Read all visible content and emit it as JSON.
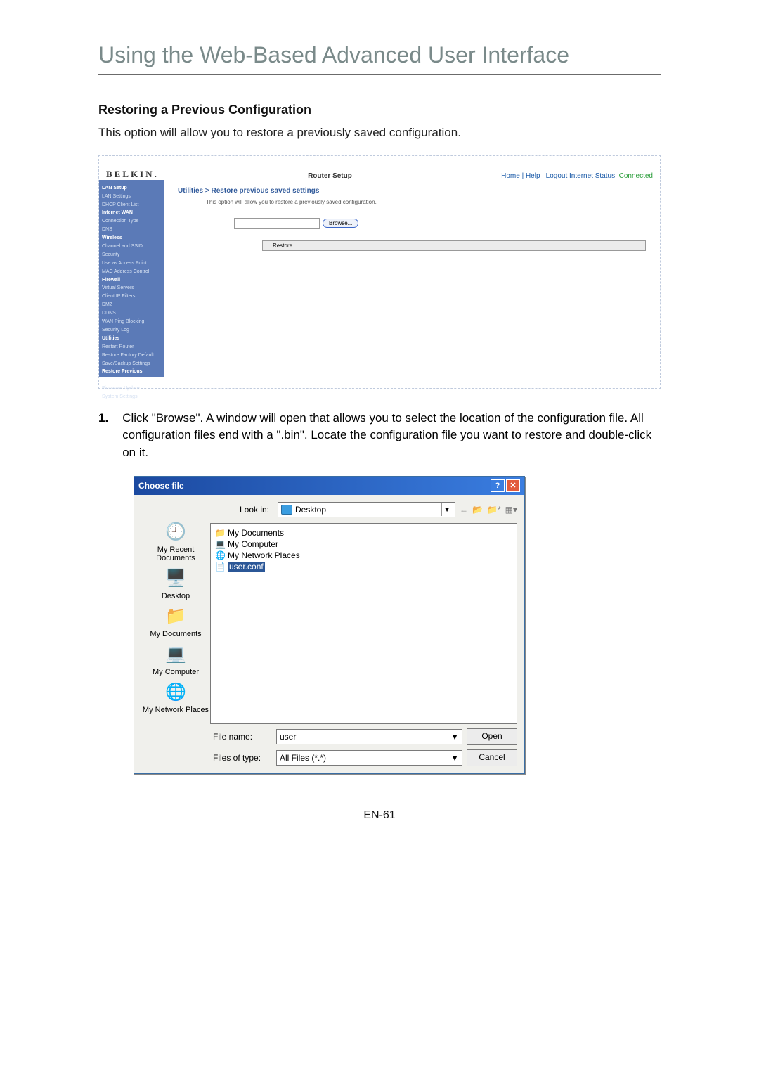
{
  "page": {
    "title": "Using the Web-Based Advanced User Interface",
    "section": "Restoring a Previous Configuration",
    "intro": "This option will allow you to restore a previously saved configuration.",
    "footer": "EN-61"
  },
  "router": {
    "brand": "BELKIN.",
    "setup": "Router Setup",
    "links": "Home | Help | Logout    Internet Status:",
    "status": "Connected",
    "crumb": "Utilities > Restore previous saved settings",
    "sub": "This option will allow you to restore a previously saved configuration.",
    "browse": "Browse...",
    "restore": "Restore",
    "side": {
      "h1": "LAN Setup",
      "i1": "LAN Settings",
      "i2": "DHCP Client List",
      "h2": "Internet WAN",
      "i3": "Connection Type",
      "i4": "DNS",
      "h3": "Wireless",
      "i5": "Channel and SSID",
      "i6": "Security",
      "i7": "Use as Access Point",
      "i8": "MAC Address Control",
      "h4": "Firewall",
      "i9": "Virtual Servers",
      "i10": "Client IP Filters",
      "i11": "DMZ",
      "i12": "DDNS",
      "i13": "WAN Ping Blocking",
      "i14": "Security Log",
      "h5": "Utilities",
      "i15": "Restart Router",
      "i16": "Restore Factory Default",
      "i17": "Save/Backup Settings",
      "i18": "Restore Previous Settings",
      "i19": "Firmware Update",
      "i20": "System Settings"
    }
  },
  "step": {
    "num": "1.",
    "text": "Click \"Browse\". A window will open that allows you to select the location of the configuration file. All configuration files end with a \".bin\". Locate the configuration file you want to restore and double-click on it."
  },
  "dialog": {
    "title": "Choose file",
    "lookin_label": "Look in:",
    "lookin_value": "Desktop",
    "places": {
      "recent": "My Recent Documents",
      "desktop": "Desktop",
      "mydocs": "My Documents",
      "mycomp": "My Computer",
      "mynet": "My Network Places"
    },
    "files": {
      "f1": "My Documents",
      "f2": "My Computer",
      "f3": "My Network Places",
      "f4": "user.conf"
    },
    "filename_label": "File name:",
    "filename_value": "user",
    "filetype_label": "Files of type:",
    "filetype_value": "All Files (*.*)",
    "open": "Open",
    "cancel": "Cancel"
  }
}
